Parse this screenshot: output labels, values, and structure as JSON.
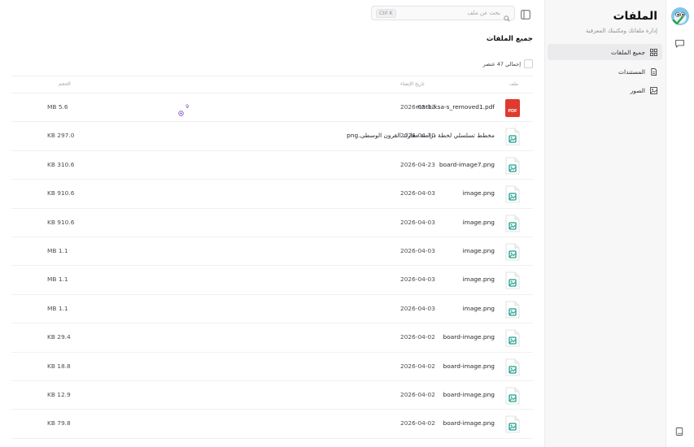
{
  "sidebar": {
    "title": "الملفات",
    "subtitle": "إدارة ملفاتك ومكتبتك المعرفية",
    "items": [
      {
        "label": "جميع الملفات",
        "icon": "grid-icon",
        "active": true
      },
      {
        "label": "المستندات",
        "icon": "document-icon",
        "active": false
      },
      {
        "label": "الصور",
        "icon": "image-icon",
        "active": false
      }
    ]
  },
  "search": {
    "placeholder": "بحث عن ملف",
    "shortcut": "Ctrl K"
  },
  "main": {
    "title": "جميع الملفات",
    "count_label": "إجمالي 47 عنصر",
    "columns": {
      "file": "ملف",
      "created": "تاريخ الإنشاء",
      "size": "الحجم"
    }
  },
  "files": [
    {
      "name": "math-ksa-s_removed1.pdf",
      "type": "pdf",
      "date": "2026-05-12",
      "size": "5.6 MB",
      "badge": "9"
    },
    {
      "name": "مخطط تسلسلي لخطة دراسة معارك القرون الوسطى.png",
      "type": "image",
      "date": "2026-04-30",
      "size": "297.0 KB"
    },
    {
      "name": "board-image7.png",
      "type": "image",
      "date": "2026-04-23",
      "size": "310.6 KB"
    },
    {
      "name": "image.png",
      "type": "image",
      "date": "2026-04-03",
      "size": "910.6 KB"
    },
    {
      "name": "image.png",
      "type": "image",
      "date": "2026-04-03",
      "size": "910.6 KB"
    },
    {
      "name": "image.png",
      "type": "image",
      "date": "2026-04-03",
      "size": "1.1 MB"
    },
    {
      "name": "image.png",
      "type": "image",
      "date": "2026-04-03",
      "size": "1.1 MB"
    },
    {
      "name": "image.png",
      "type": "image",
      "date": "2026-04-03",
      "size": "1.1 MB"
    },
    {
      "name": "board-image.png",
      "type": "image",
      "date": "2026-04-02",
      "size": "29.4 KB"
    },
    {
      "name": "board-image.png",
      "type": "image",
      "date": "2026-04-02",
      "size": "18.8 KB"
    },
    {
      "name": "board-image.png",
      "type": "image",
      "date": "2026-04-02",
      "size": "12.9 KB"
    },
    {
      "name": "board-image.png",
      "type": "image",
      "date": "2026-04-02",
      "size": "79.8 KB"
    }
  ],
  "colors": {
    "pdf": "#e03a2f",
    "image_icon": "#1e9e8c",
    "badge": "#7b3fc4",
    "active_bg": "#ebebed"
  }
}
